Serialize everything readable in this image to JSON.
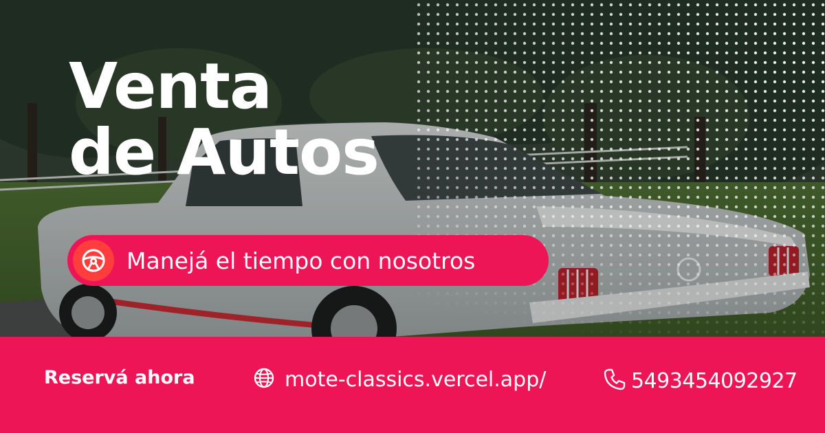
{
  "headline": {
    "line1": "Venta",
    "line2": "de Autos"
  },
  "tagline": {
    "text": "Manejá el tiempo con nosotros",
    "icon": "steering-wheel-icon"
  },
  "footer": {
    "cta": "Reservá ahora",
    "website": "mote-classics.vercel.app/",
    "website_icon": "globe-icon",
    "phone": "5493454092927",
    "phone_icon": "phone-icon"
  },
  "colors": {
    "accent": "#ee1556",
    "badge": "#ff3d3d",
    "text": "#ffffff"
  }
}
